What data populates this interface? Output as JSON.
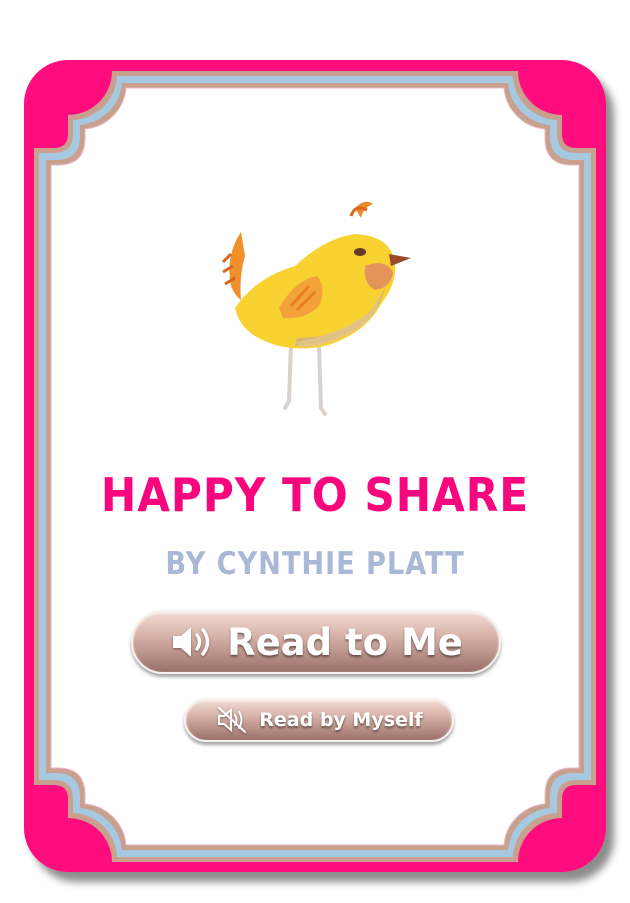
{
  "book": {
    "title": "HAPPY TO SHARE",
    "author": "BY CYNTHIE PLATT",
    "cover_image": "yellow-bird-illustration"
  },
  "actions": {
    "read_to_me": {
      "label": "Read to Me",
      "icon": "speaker-icon"
    },
    "read_by_myself": {
      "label": "Read by Myself",
      "icon": "speaker-muted-icon"
    }
  },
  "colors": {
    "frame_outer": "#ff0a7e",
    "frame_border": "#a6c8e0",
    "frame_tan": "#c9a08e",
    "title": "#f8067e",
    "author": "#a9b8d6",
    "button": "#c19b92"
  }
}
